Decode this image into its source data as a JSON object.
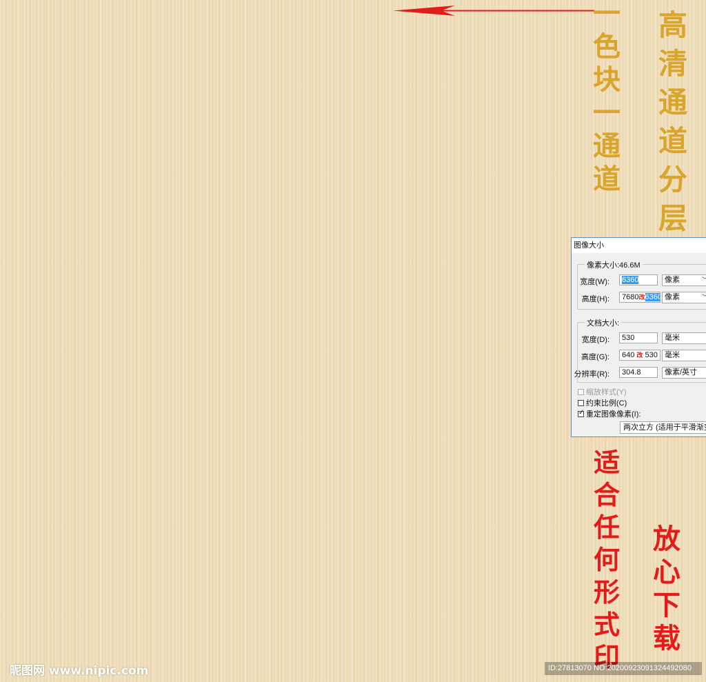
{
  "background": {
    "color": "#f1dfb9"
  },
  "annotations": {
    "gold_left": [
      "一",
      "色",
      "块",
      "一",
      "通",
      "道"
    ],
    "gold_right": [
      "高",
      "清",
      "通",
      "道",
      "分",
      "层"
    ],
    "red_left": [
      "适",
      "合",
      "任",
      "何",
      "形",
      "式",
      "印"
    ],
    "red_right": [
      "放",
      "心",
      "下",
      "载"
    ],
    "gold_color": "#d9a52a",
    "red_color": "#e41b1b"
  },
  "arrow": {
    "color": "#e41b1b",
    "direction": "left"
  },
  "dialog": {
    "title": "图像大小",
    "pixel_group": {
      "label": "像素大小:46.6M",
      "width_label": "宽度(W):",
      "width_value": "6360",
      "width_unit": "像素",
      "height_label": "高度(H):",
      "height_value_old": "7680",
      "height_mark": "改",
      "height_value_new": "6360",
      "height_unit": "像素"
    },
    "doc_group": {
      "label": "文档大小:",
      "width_label": "宽度(D):",
      "width_value": "530",
      "width_unit": "毫米",
      "height_label": "高度(G):",
      "height_value_old": "640",
      "height_mark": "改",
      "height_value_new": "530",
      "height_unit": "毫米",
      "resolution_label": "分辨率(R):",
      "resolution_value": "304.8",
      "resolution_unit": "像素/英寸"
    },
    "options": {
      "scale_styles": "缩放样式(Y)",
      "constrain": "约束比例(C)",
      "resample": "重定图像像素(I):",
      "resample_method": "两次立方 (适用于平滑渐变"
    }
  },
  "watermark": {
    "left": "昵图网 www.nipic.com",
    "right": "ID:27813070 NO:20200923091324492080"
  }
}
